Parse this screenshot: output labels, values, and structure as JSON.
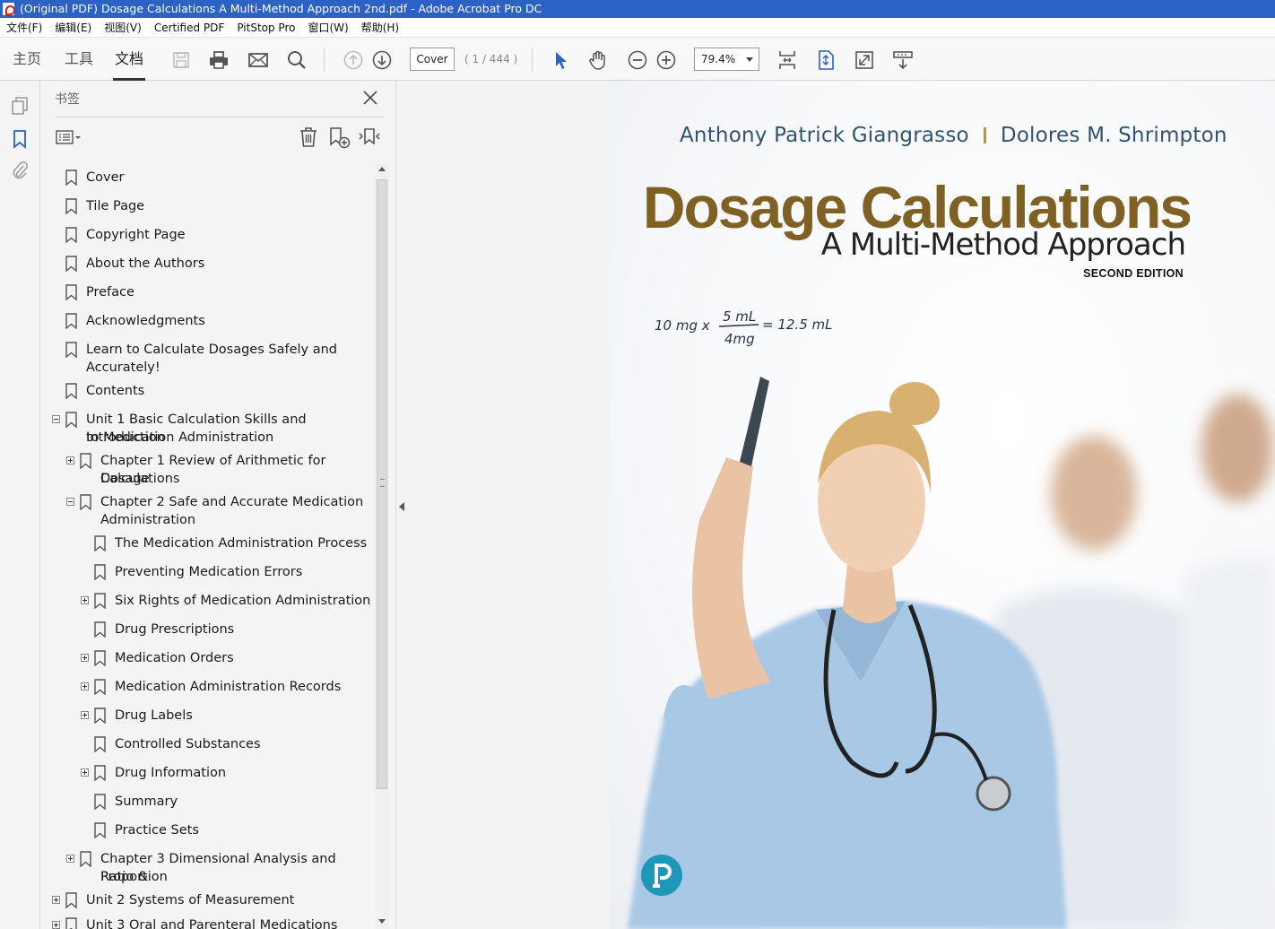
{
  "window": {
    "title": "(Original PDF) Dosage Calculations A Multi-Method Approach 2nd.pdf - Adobe Acrobat Pro DC"
  },
  "menu": [
    "文件(F)",
    "编辑(E)",
    "视图(V)",
    "Certified PDF",
    "PitStop Pro",
    "窗口(W)",
    "帮助(H)"
  ],
  "toolbar": {
    "tabs": {
      "home": "主页",
      "tools": "工具",
      "document": "文档"
    },
    "page_label": "Cover",
    "page_count": "( 1 / 444 )",
    "zoom": "79.4%"
  },
  "bookmarks": {
    "title": "书签",
    "items": [
      {
        "label": "Cover"
      },
      {
        "label": "Tile Page"
      },
      {
        "label": "Copyright Page"
      },
      {
        "label": "About the Authors"
      },
      {
        "label": "Preface"
      },
      {
        "label": "Acknowledgments"
      },
      {
        "label_l1": "Learn to Calculate Dosages Safely and",
        "label_l2": "Accurately!"
      },
      {
        "label": "Contents"
      },
      {
        "label_l1": "Unit 1 Basic Calculation Skills and Introduction",
        "label_l2": "to Medication Administration"
      },
      {
        "label_l1": "Chapter 1 Review of Arithmetic for Dosage",
        "label_l2": "Calculations"
      },
      {
        "label_l1": "Chapter 2 Safe and Accurate Medication",
        "label_l2": "Administration"
      },
      {
        "label": "The Medication Administration Process"
      },
      {
        "label": "Preventing Medication Errors"
      },
      {
        "label": "Six Rights of Medication Administration"
      },
      {
        "label": "Drug Prescriptions"
      },
      {
        "label": "Medication Orders"
      },
      {
        "label": "Medication Administration Records"
      },
      {
        "label": "Drug Labels"
      },
      {
        "label": "Controlled Substances"
      },
      {
        "label": "Drug Information"
      },
      {
        "label": "Summary"
      },
      {
        "label": "Practice Sets"
      },
      {
        "label_l1": "Chapter 3 Dimensional Analysis and Ratio &",
        "label_l2": "Proportion"
      },
      {
        "label": "Unit 2 Systems of Measurement"
      },
      {
        "label": "Unit 3 Oral and Parenteral Medications"
      }
    ]
  },
  "cover": {
    "author1": "Anthony Patrick Giangrasso",
    "author2": "Dolores M. Shrimpton",
    "title": "Dosage Calculations",
    "subtitle": "A Multi-Method Approach",
    "edition": "SECOND EDITION",
    "formula": {
      "left": "10 mg x",
      "numerator": "5 mL",
      "denominator": "4mg",
      "result": "= 12.5 mL"
    }
  },
  "colors": {
    "title_bar": "#2b62c3",
    "title_brown": "#806124",
    "author_blue": "#2f5470",
    "scrub_blue": "#a8c8e6",
    "pearson_teal": "#1f97b8"
  }
}
